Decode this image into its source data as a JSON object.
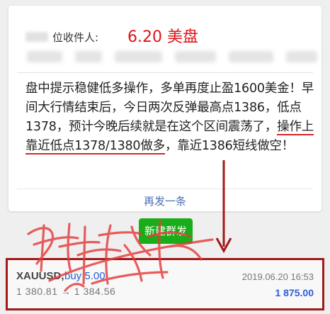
{
  "header": {
    "recipient_label": "位收件人:",
    "date_title": "6.20 美盘"
  },
  "message": {
    "text_before": "盘中提示稳健低多操作，多单再度止盈1600美金！早间大行情结束后，今日两次反弹最高点1386，低点1378，预计今晚后续就是在这个区间震荡了，",
    "text_highlight": "操作上靠近低点1378/1380做多",
    "text_after": "，靠近1386短线做空！"
  },
  "actions": {
    "resend_label": "再发一条",
    "new_button_label": "新建群发"
  },
  "trade": {
    "symbol": "XAUUSD,",
    "side": "buy 5.00",
    "open_price": "1 380.81",
    "arrow": "→",
    "close_price": "1 384.56",
    "datetime": "2019.06.20 16:53",
    "profit": "1 875.00"
  },
  "colors": {
    "red": "#e0141a",
    "green_button": "#1aad19",
    "link_blue": "#4a6fb5",
    "trade_blue": "#2d5fd8",
    "border_red": "#a31919"
  }
}
